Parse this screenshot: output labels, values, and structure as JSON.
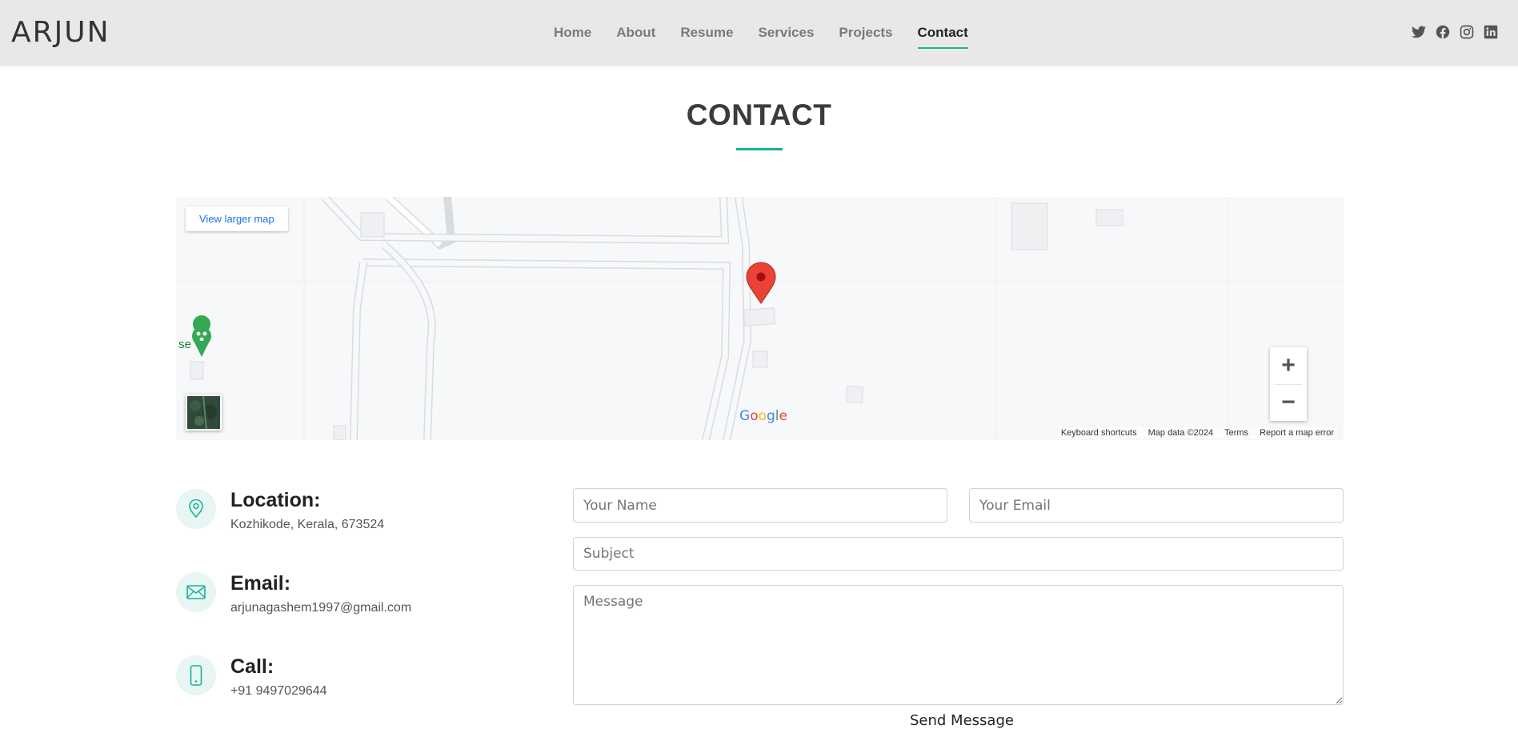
{
  "header": {
    "logo": "ARJUN",
    "nav": [
      {
        "label": "Home",
        "active": false
      },
      {
        "label": "About",
        "active": false
      },
      {
        "label": "Resume",
        "active": false
      },
      {
        "label": "Services",
        "active": false
      },
      {
        "label": "Projects",
        "active": false
      },
      {
        "label": "Contact",
        "active": true
      }
    ],
    "social": [
      "twitter-icon",
      "facebook-icon",
      "instagram-icon",
      "linkedin-icon"
    ]
  },
  "section": {
    "title": "CONTACT",
    "accent_color": "#18b39a"
  },
  "map": {
    "larger_map_label": "View larger map",
    "zoom_in": "+",
    "zoom_out": "−",
    "google_logo": "Google",
    "poi_label": "se",
    "footer": {
      "keyboard": "Keyboard shortcuts",
      "map_data": "Map data ©2024",
      "terms": "Terms",
      "report": "Report a map error"
    }
  },
  "info": {
    "location": {
      "title": "Location:",
      "text": "Kozhikode, Kerala, 673524"
    },
    "email": {
      "title": "Email:",
      "text": "arjunagashem1997@gmail.com"
    },
    "call": {
      "title": "Call:",
      "text": "+91 9497029644"
    }
  },
  "form": {
    "name_placeholder": "Your Name",
    "email_placeholder": "Your Email",
    "subject_placeholder": "Subject",
    "message_placeholder": "Message",
    "send_label": "Send Message"
  }
}
